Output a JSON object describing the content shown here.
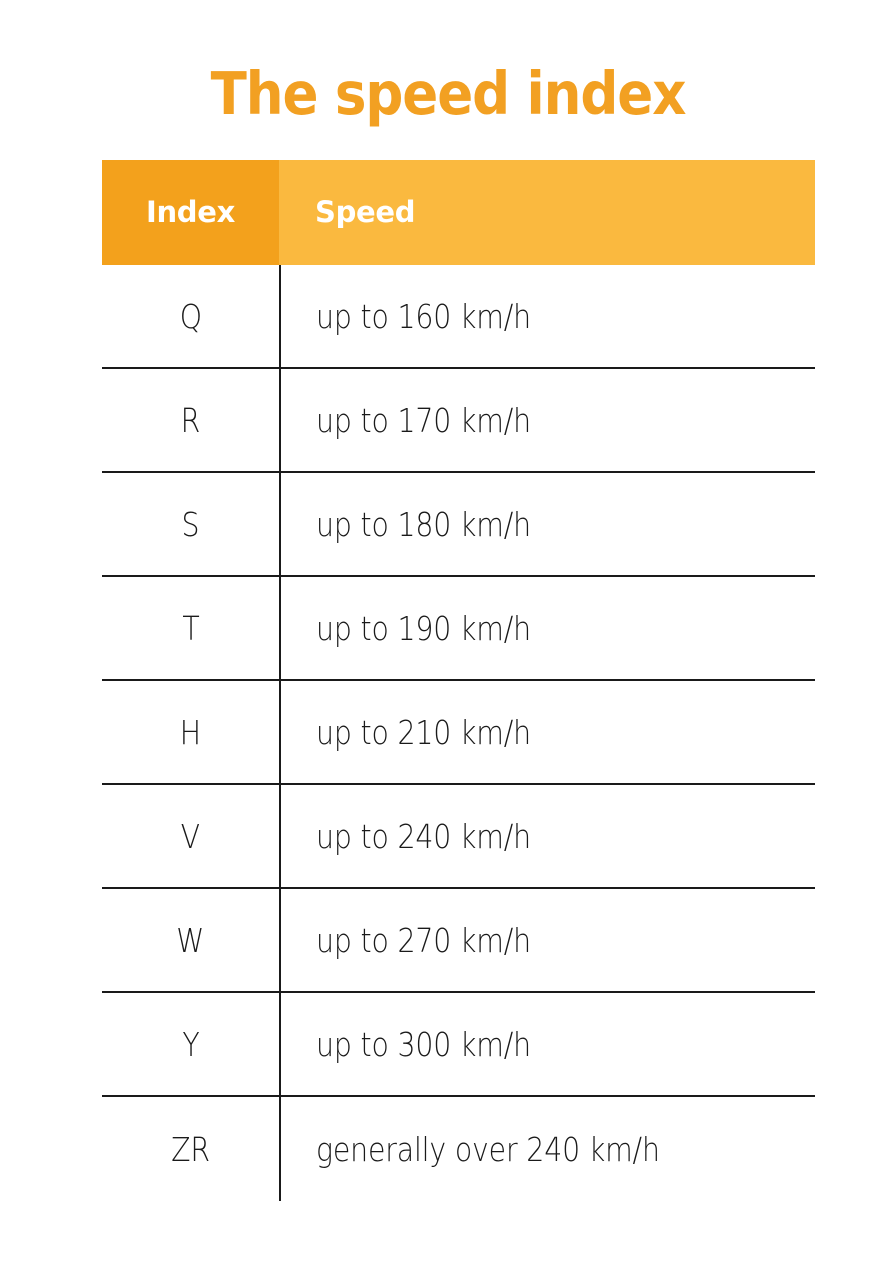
{
  "page": {
    "title": "The speed index",
    "background_color": "#ffffff"
  },
  "colors": {
    "title_orange": "#F2A022",
    "header_index_bg": "#F3A11C",
    "header_speed_bg": "#FAB93F",
    "header_text": "#ffffff",
    "body_text": "#1a1a1a",
    "rule": "#1a1a1a"
  },
  "table": {
    "columns": [
      {
        "key": "index",
        "label": "Index",
        "align": "center"
      },
      {
        "key": "speed",
        "label": "Speed",
        "align": "left"
      }
    ],
    "rows": [
      {
        "index": "Q",
        "speed": "up to 160 km/h"
      },
      {
        "index": "R",
        "speed": "up to 170 km/h"
      },
      {
        "index": "S",
        "speed": "up to 180 km/h"
      },
      {
        "index": "T",
        "speed": "up to 190 km/h"
      },
      {
        "index": "H",
        "speed": "up to 210 km/h"
      },
      {
        "index": "V",
        "speed": "up to 240 km/h"
      },
      {
        "index": "W",
        "speed": "up to 270 km/h"
      },
      {
        "index": "Y",
        "speed": "up to 300 km/h"
      },
      {
        "index": "ZR",
        "speed": "generally over 240 km/h"
      }
    ]
  }
}
